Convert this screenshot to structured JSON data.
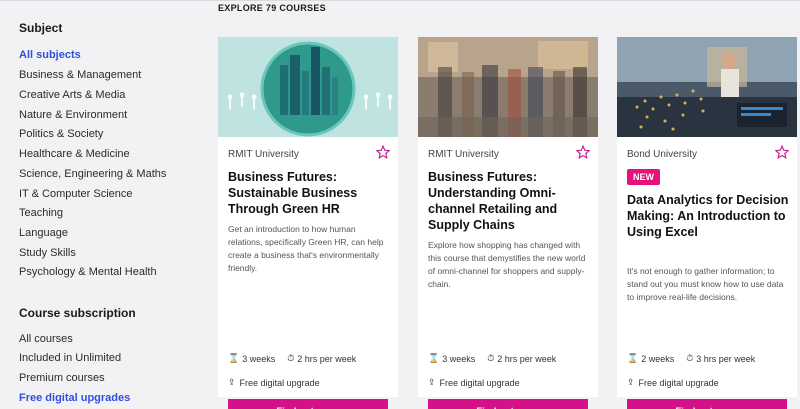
{
  "sidebar": {
    "subject_heading": "Subject",
    "subjects": [
      {
        "label": "All subjects",
        "active": true
      },
      {
        "label": "Business & Management"
      },
      {
        "label": "Creative Arts & Media"
      },
      {
        "label": "Nature & Environment"
      },
      {
        "label": "Politics & Society"
      },
      {
        "label": "Healthcare & Medicine"
      },
      {
        "label": "Science, Engineering & Maths"
      },
      {
        "label": "IT & Computer Science"
      },
      {
        "label": "Teaching"
      },
      {
        "label": "Language"
      },
      {
        "label": "Study Skills"
      },
      {
        "label": "Psychology & Mental Health"
      }
    ],
    "subscription_heading": "Course subscription",
    "subscriptions": [
      {
        "label": "All courses"
      },
      {
        "label": "Included in Unlimited"
      },
      {
        "label": "Premium courses"
      },
      {
        "label": "Free digital upgrades",
        "active": true
      }
    ]
  },
  "main": {
    "explore_label": "EXPLORE 79 COURSES",
    "cards": [
      {
        "org": "RMIT University",
        "badge": "",
        "title": "Business Futures: Sustainable Business Through Green HR",
        "description": "Get an introduction to how human relations, specifically Green HR, can help create a business that's environmentally friendly.",
        "duration": "3 weeks",
        "effort": "2 hrs per week",
        "upgrade": "Free digital upgrade",
        "button": "Find out more",
        "image": "green-city-image"
      },
      {
        "org": "RMIT University",
        "badge": "",
        "title": "Business Futures: Understanding Omni-channel Retailing and Supply Chains",
        "description": "Explore how shopping has changed with this course that demystifies the new world of omni-channel for shoppers and supply-chain.",
        "duration": "3 weeks",
        "effort": "2 hrs per week",
        "upgrade": "Free digital upgrade",
        "button": "Find out more",
        "image": "shopping-crowd-image"
      },
      {
        "org": "Bond University",
        "badge": "NEW",
        "title": "Data Analytics for Decision Making: An Introduction to Using Excel",
        "description": "It's not enough to gather information; to stand out you must know how to use data to improve real-life decisions.",
        "duration": "2 weeks",
        "effort": "3 hrs per week",
        "upgrade": "Free digital upgrade",
        "button": "Find out more",
        "image": "data-office-image"
      }
    ]
  },
  "colors": {
    "accent_link": "#2f4fe0",
    "button": "#d5118a",
    "badge": "#e5127c",
    "star": "#c81d8e"
  }
}
